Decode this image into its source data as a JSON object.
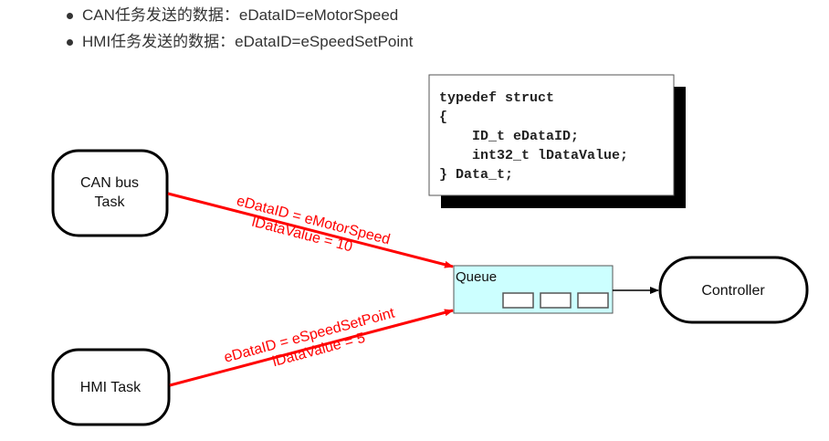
{
  "bullets": [
    "CAN任务发送的数据：eDataID=eMotorSpeed",
    "HMI任务发送的数据：eDataID=eSpeedSetPoint"
  ],
  "diagram": {
    "code_lines": [
      "typedef struct",
      "{",
      "    ID_t eDataID;",
      "    int32_t lDataValue;",
      "} Data_t;"
    ],
    "nodes": {
      "can_line1": "CAN bus",
      "can_line2": "Task",
      "hmi": "HMI Task",
      "queue": "Queue",
      "controller": "Controller"
    },
    "edges": {
      "can_label1": "eDataID = eMotorSpeed",
      "can_label2": "lDataValue = 10",
      "hmi_label1": "eDataID = eSpeedSetPoint",
      "hmi_label2": "lDataValue = 5"
    },
    "colors": {
      "arrow": "#ff0000",
      "queue_fill": "#ccffff"
    }
  }
}
